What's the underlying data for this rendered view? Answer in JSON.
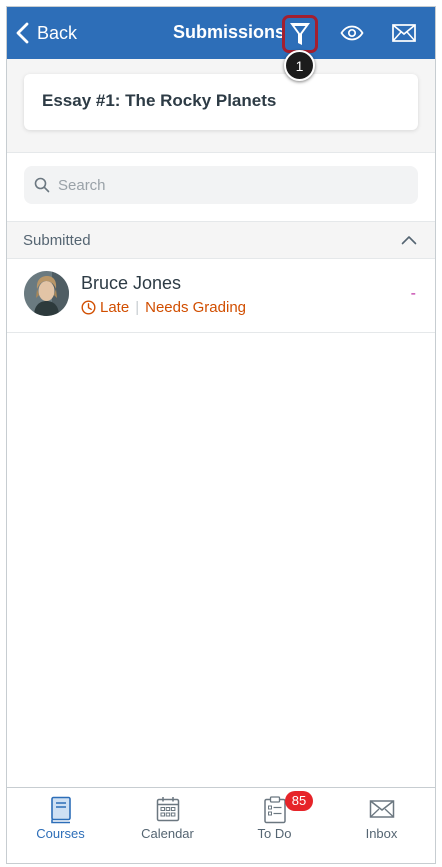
{
  "header": {
    "back_label": "Back",
    "title": "Submissions",
    "background_color": "#2d6eb8",
    "callout_number": "1",
    "icons": [
      "chevron-left-icon",
      "filter-icon",
      "eye-icon",
      "mail-icon"
    ]
  },
  "assignment": {
    "name": "Essay #1: The Rocky Planets"
  },
  "search": {
    "placeholder": "Search",
    "value": ""
  },
  "section": {
    "title": "Submitted",
    "expanded": true
  },
  "submissions": [
    {
      "name": "Bruce Jones",
      "status_late": "Late",
      "status_grading": "Needs Grading",
      "grade": "-",
      "status_color": "#d14e00",
      "grade_color": "#bf32a4"
    }
  ],
  "tabbar": {
    "tabs": [
      {
        "label": "Courses",
        "icon": "book-icon",
        "active": true
      },
      {
        "label": "Calendar",
        "icon": "calendar-icon",
        "active": false
      },
      {
        "label": "To Do",
        "icon": "clipboard-icon",
        "active": false
      },
      {
        "label": "Inbox",
        "icon": "mail-icon",
        "active": false
      }
    ],
    "todo_badge": "85",
    "active_color": "#2d6eb8"
  }
}
